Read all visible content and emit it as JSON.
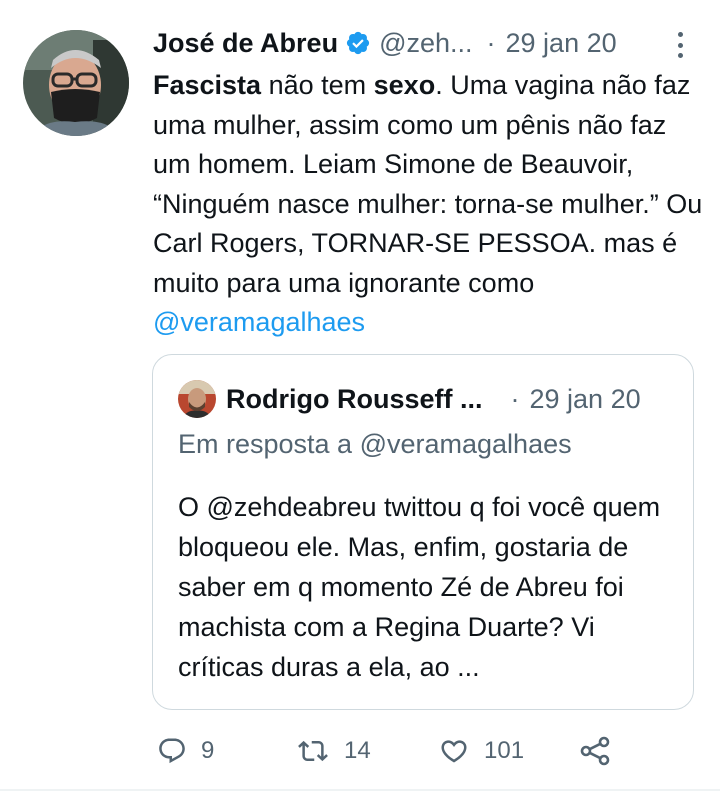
{
  "tweet": {
    "author_name": "José de Abreu",
    "handle": "@zeh...",
    "separator": "·",
    "date": "29 jan 20",
    "body": {
      "w1": "Fascista",
      "t1": " não tem ",
      "w2": "sexo",
      "t2": ". Uma vagina não faz uma mulher, assim como um pênis não faz um homem. Leiam Simone de Beauvoir, “Ninguém nasce mulher: torna-se mulher.” Ou Carl Rogers, TORNAR-SE PESSOA. mas é muito para uma ignorante como ",
      "mention": "@veramagalhaes"
    }
  },
  "quoted_tweet": {
    "author_name": "Rodrigo Rousseff ...",
    "separator": "·",
    "date": "29 jan 20",
    "reply_to": "Em resposta a @veramagalhaes",
    "text": "O @zehdeabreu twittou q foi você quem bloqueou ele. Mas, enfim, gostaria de saber em q momento Zé de Abreu foi machista com a Regina Duarte? Vi críticas duras a ela, ao ..."
  },
  "actions": {
    "reply_count": "9",
    "retweet_count": "14",
    "like_count": "101"
  },
  "icons": {
    "verified": "verified-badge-icon",
    "more": "more-vertical-icon",
    "reply": "reply-icon",
    "retweet": "retweet-icon",
    "like": "heart-icon",
    "share": "share-icon"
  },
  "colors": {
    "accent": "#1d9bf0",
    "text": "#0f1419",
    "muted": "#536471",
    "border": "#cfd9de"
  }
}
